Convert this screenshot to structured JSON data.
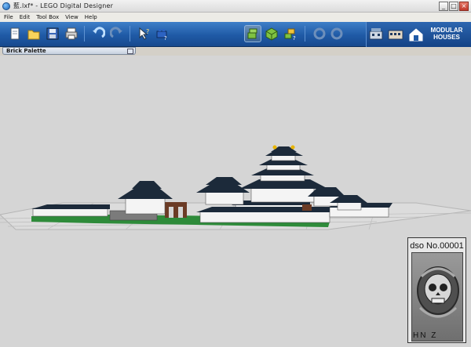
{
  "window": {
    "title": "藍.lxf* - LEGO Digital Designer",
    "buttons": {
      "minimize": "_",
      "maximize": "□",
      "close": "×"
    }
  },
  "menu": {
    "items": [
      "File",
      "Edit",
      "Tool Box",
      "View",
      "Help"
    ]
  },
  "toolbar": {
    "buttons": [
      {
        "name": "new-icon"
      },
      {
        "name": "open-folder-icon"
      },
      {
        "name": "save-icon"
      },
      {
        "name": "print-icon"
      },
      {
        "name": "undo-icon"
      },
      {
        "name": "redo-icon"
      },
      {
        "name": "help-cursor-icon"
      },
      {
        "name": "brick-help-icon"
      },
      {
        "name": "build-mode-icon"
      },
      {
        "name": "view-mode-icon"
      },
      {
        "name": "building-guide-icon"
      },
      {
        "name": "rotate-left-icon"
      },
      {
        "name": "rotate-right-icon"
      }
    ],
    "theme_label_line1": "MODULAR",
    "theme_label_line2": "HOUSES"
  },
  "palette": {
    "title": "Brick Palette"
  },
  "badge": {
    "title": "dso No.00001",
    "footer": "HN  Z"
  },
  "colors": {
    "toolbar_blue": "#1f5aa6",
    "canvas_gray": "#d5d5d5",
    "roof_dark": "#1c2a3a",
    "wall_white": "#f4f4f4",
    "grass_green": "#2e8b3a",
    "gate_brown": "#6b3b25",
    "gold": "#e8b400"
  }
}
